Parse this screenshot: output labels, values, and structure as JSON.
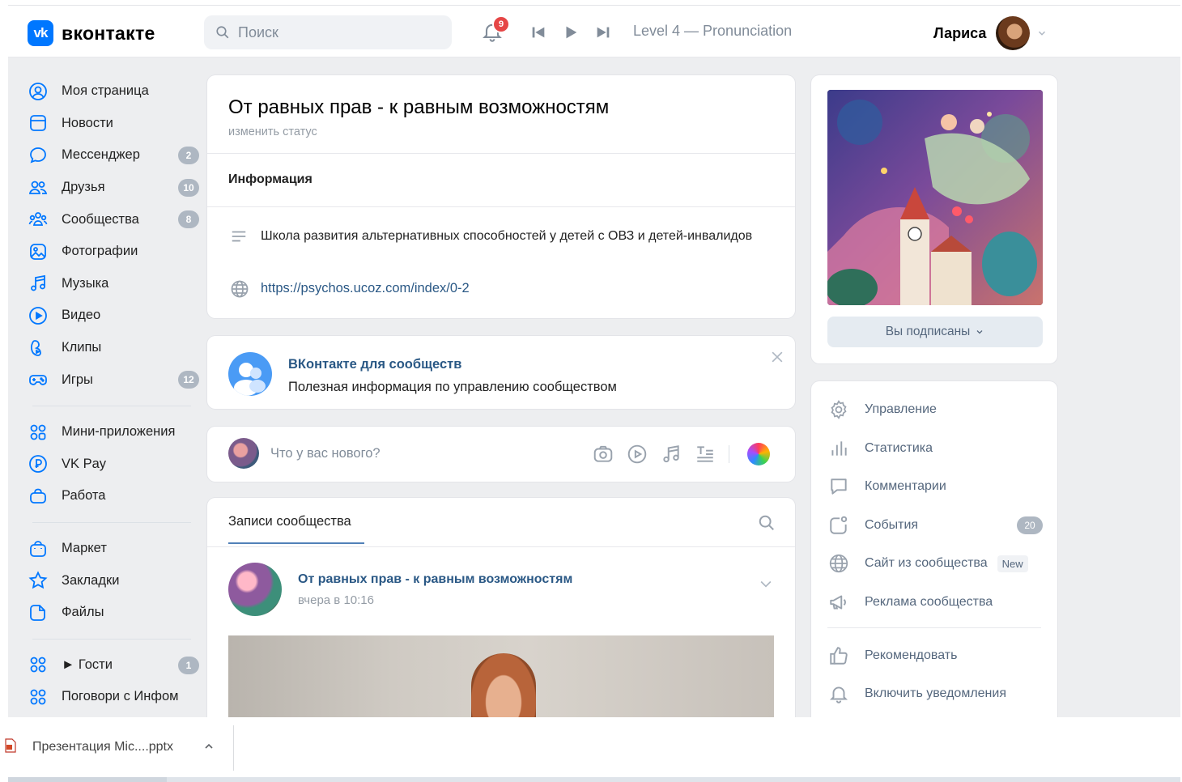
{
  "header": {
    "logo_text": "вконтакте",
    "logo_mark": "vk",
    "search_placeholder": "Поиск",
    "notifications_count": "9",
    "track_title": "Level 4 — Pronunciation",
    "user_name": "Лариса"
  },
  "sidebar": {
    "items": [
      {
        "label": "Моя страница",
        "icon": "user-circle-icon",
        "badge": ""
      },
      {
        "label": "Новости",
        "icon": "news-icon",
        "badge": ""
      },
      {
        "label": "Мессенджер",
        "icon": "chat-bubble-icon",
        "badge": "2"
      },
      {
        "label": "Друзья",
        "icon": "friends-icon",
        "badge": "10"
      },
      {
        "label": "Сообщества",
        "icon": "communities-icon",
        "badge": "8"
      },
      {
        "label": "Фотографии",
        "icon": "photo-icon",
        "badge": ""
      },
      {
        "label": "Музыка",
        "icon": "music-note-icon",
        "badge": ""
      },
      {
        "label": "Видео",
        "icon": "video-play-icon",
        "badge": ""
      },
      {
        "label": "Клипы",
        "icon": "clips-icon",
        "badge": ""
      },
      {
        "label": "Игры",
        "icon": "gamepad-icon",
        "badge": "12"
      }
    ],
    "apps": [
      {
        "label": "Мини-приложения",
        "icon": "mini-apps-icon"
      },
      {
        "label": "VK Pay",
        "icon": "vkpay-icon"
      },
      {
        "label": "Работа",
        "icon": "briefcase-icon"
      }
    ],
    "extras": [
      {
        "label": "Маркет",
        "icon": "market-bag-icon"
      },
      {
        "label": "Закладки",
        "icon": "star-icon"
      },
      {
        "label": "Файлы",
        "icon": "file-icon"
      }
    ],
    "games": [
      {
        "label": "► Гости",
        "icon": "app-grid-icon",
        "badge": "1"
      },
      {
        "label": "Поговори с Инфом",
        "icon": "app-grid-icon",
        "badge": ""
      }
    ]
  },
  "profile": {
    "title": "От равных прав - к равным возможностям",
    "edit_status": "изменить статус",
    "info_title": "Информация",
    "description": "Школа развития альтернативных способностей у детей с ОВЗ и детей-инвалидов",
    "website": "https://psychos.ucoz.com/index/0-2"
  },
  "promo": {
    "title": "ВКонтакте для сообществ",
    "subtitle": "Полезная информация по управлению сообществом"
  },
  "composer": {
    "placeholder": "Что у вас нового?"
  },
  "wall": {
    "tab_label": "Записи сообщества",
    "post_author": "От равных прав - к равным возможностям",
    "post_time": "вчера в 10:16"
  },
  "right": {
    "subscribed_label": "Вы подписаны",
    "actions": [
      {
        "label": "Управление",
        "icon": "gear-icon",
        "badge": "",
        "tag": ""
      },
      {
        "label": "Статистика",
        "icon": "stats-bars-icon",
        "badge": "",
        "tag": ""
      },
      {
        "label": "Комментарии",
        "icon": "comment-icon",
        "badge": "",
        "tag": ""
      },
      {
        "label": "События",
        "icon": "events-icon",
        "badge": "20",
        "tag": ""
      },
      {
        "label": "Сайт из сообщества",
        "icon": "globe-icon",
        "badge": "",
        "tag": "New"
      },
      {
        "label": "Реклама сообщества",
        "icon": "megaphone-icon",
        "badge": "",
        "tag": ""
      },
      {
        "label": "Рекомендовать",
        "icon": "thumbs-up-icon",
        "badge": "",
        "tag": ""
      },
      {
        "label": "Включить уведомления",
        "icon": "bell-icon",
        "badge": "",
        "tag": ""
      }
    ]
  },
  "download": {
    "file_name": "Презентация Mic....pptx"
  },
  "colors": {
    "accent": "#0077ff",
    "link": "#2a5885",
    "badge": "#aeb7c2",
    "notification": "#e64646",
    "background": "#edeef0"
  }
}
